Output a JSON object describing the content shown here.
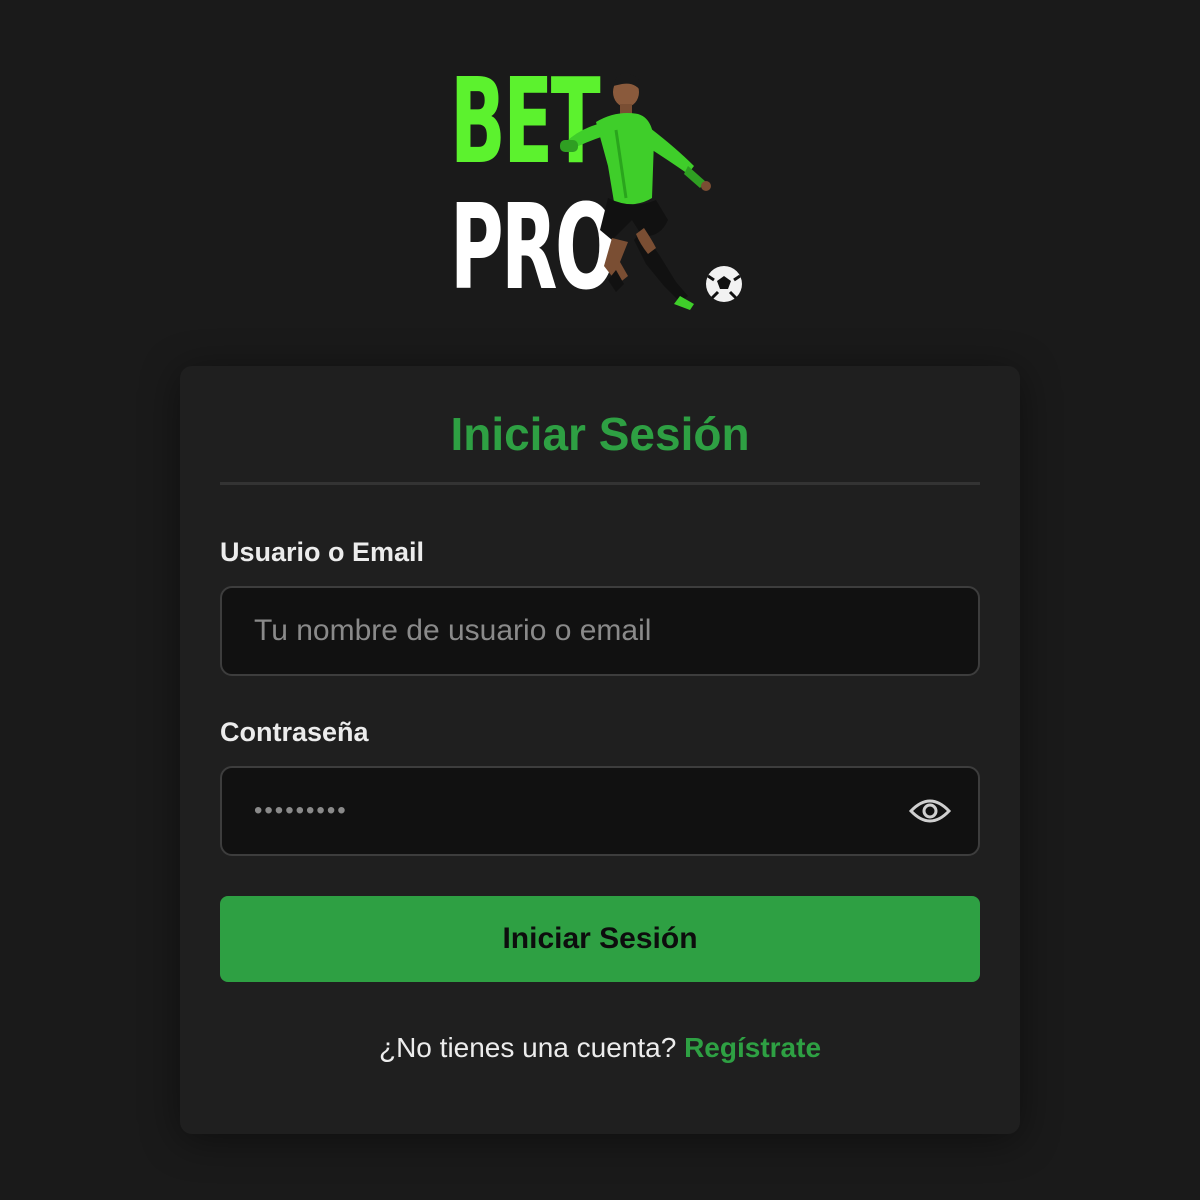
{
  "logo": {
    "line1": "BET",
    "line2": "PRO",
    "colors": {
      "bet": "#5cf22e",
      "pro": "#ffffff"
    },
    "illustration": "soccer-player-kicking-ball"
  },
  "login": {
    "title": "Iniciar Sesión",
    "username": {
      "label": "Usuario o Email",
      "placeholder": "Tu nombre de usuario o email",
      "value": ""
    },
    "password": {
      "label": "Contraseña",
      "value": "•••••••••",
      "toggle_icon": "eye-icon"
    },
    "submit_label": "Iniciar Sesión",
    "register_prompt": "¿No tienes una cuenta?",
    "register_link": "Regístrate"
  },
  "colors": {
    "background": "#1a1a1a",
    "card": "#1f1f1f",
    "accent": "#2ea043",
    "input_bg": "#111111"
  }
}
